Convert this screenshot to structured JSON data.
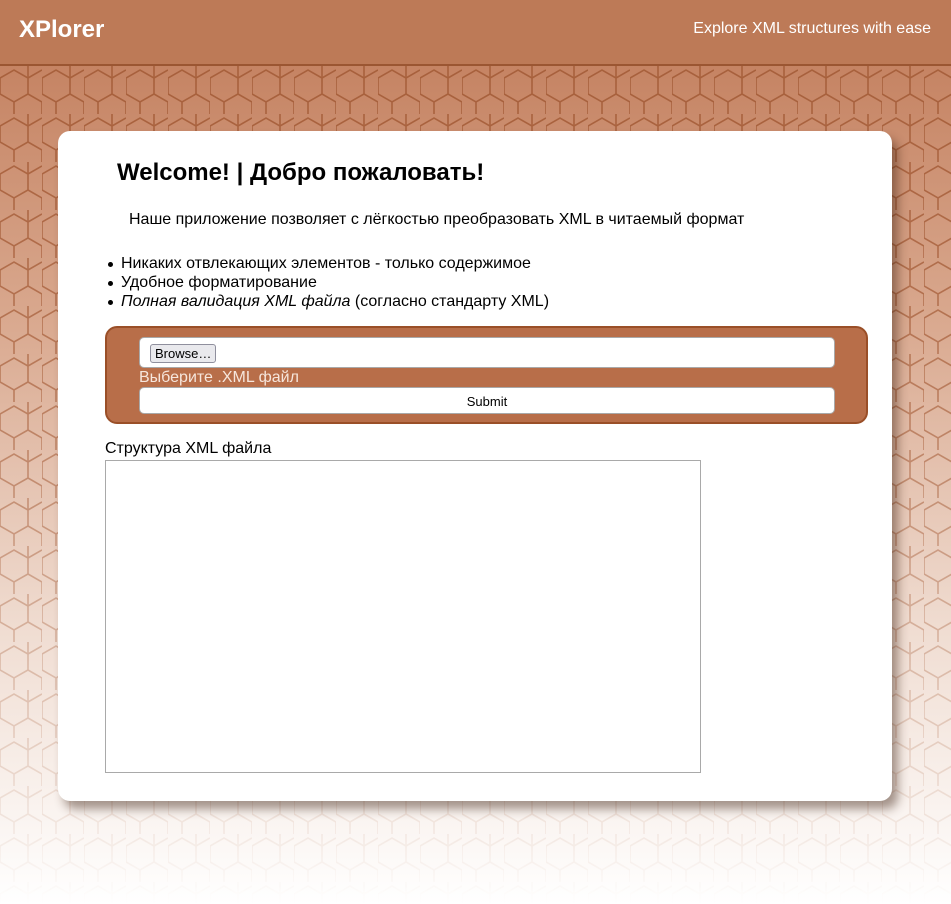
{
  "header": {
    "brand": "XPlorer",
    "tagline": "Explore XML structures with ease"
  },
  "main": {
    "title": "Welcome! | Добро пожаловать!",
    "intro": "Наше приложение позволяет с лёгкостью преобразовать XML в читаемый формат",
    "features": [
      "Никаких отвлекающих элементов - только содержимое",
      "Удобное форматирование"
    ],
    "feature_validation_italic": "Полная валидация XML файла",
    "feature_validation_rest": " (согласно стандарту XML)"
  },
  "upload": {
    "browse_label": "Browse…",
    "file_label": "Выберите .XML файл",
    "submit_label": "Submit"
  },
  "structure": {
    "label": "Структура XML файла",
    "value": ""
  },
  "colors": {
    "header_bg": "#bd7a57",
    "uploader_bg": "#b86e49",
    "uploader_border": "#9a4f28"
  }
}
